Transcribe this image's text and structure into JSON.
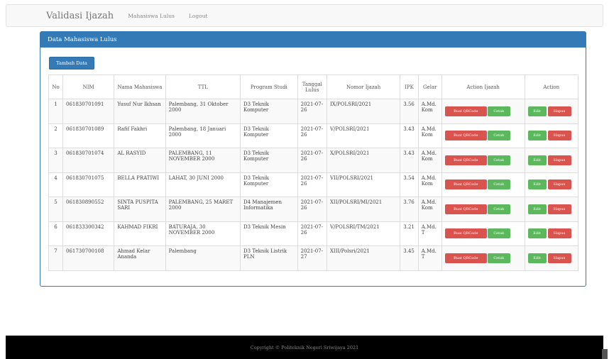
{
  "nav": {
    "brand": "Validasi Ijazah",
    "links": [
      "Mahasiswa Lulus",
      "Logout"
    ]
  },
  "panel": {
    "title": "Data Mahasiswa Lulus",
    "add_button": "Tambah Data"
  },
  "table": {
    "headers": [
      "No",
      "NIM",
      "Nama Mahasiswa",
      "TTL",
      "Program Studi",
      "Tanggal Lulus",
      "Nomor Ijazah",
      "IPK",
      "Gelar",
      "Action Ijazah",
      "Action"
    ],
    "rows": [
      {
        "no": "1",
        "nim": "061830701091",
        "nama": "Yusuf Nur Ikhsan",
        "ttl": "Palembang, 31 Oktober 2000",
        "prodi": "D3 Teknik Komputer",
        "tanggal": "2021-07-26",
        "ijazah": "IX/POLSRI/2021",
        "ipk": "3.56",
        "gelar": "A.Md. Kom"
      },
      {
        "no": "2",
        "nim": "061830701089",
        "nama": "Rafif Fakhri",
        "ttl": "Palembang, 18 Januari 2000",
        "prodi": "D3 Teknik Komputer",
        "tanggal": "2021-07-26",
        "ijazah": "V/POLSRI/2021",
        "ipk": "3.43",
        "gelar": "A.Md. Kom"
      },
      {
        "no": "3",
        "nim": "061830701074",
        "nama": "AL RASYID",
        "ttl": "PALEMBANG, 11 NOVEMBER 2000",
        "prodi": "D3 Teknik Komputer",
        "tanggal": "2021-07-26",
        "ijazah": "X/POLSRI/2021",
        "ipk": "3.43",
        "gelar": "A.Md. Kom"
      },
      {
        "no": "4",
        "nim": "061830701075",
        "nama": "BELLA PRATIWI",
        "ttl": "LAHAT, 30 JUNI 2000",
        "prodi": "D3 Teknik Komputer",
        "tanggal": "2021-07-26",
        "ijazah": "VII/POLSRI/2021",
        "ipk": "3.54",
        "gelar": "A.Md. Kom"
      },
      {
        "no": "5",
        "nim": "061830890552",
        "nama": "SINTA PUSPITA SARI",
        "ttl": "PALEMBANG, 25 MARET 2000",
        "prodi": "D4 Manajemen Informatika",
        "tanggal": "2021-07-26",
        "ijazah": "XII/POLSRI/MI/2021",
        "ipk": "3.76",
        "gelar": "A.Md. Kom"
      },
      {
        "no": "6",
        "nim": "061833300342",
        "nama": "KAHMAD FIKRI",
        "ttl": "BATURAJA, 30 NOVEMBER 2000",
        "prodi": "D3 Teknik Mesin",
        "tanggal": "2021-07-26",
        "ijazah": "V/POLSRI/TM/2021",
        "ipk": "3.21",
        "gelar": "A.Md. T"
      },
      {
        "no": "7",
        "nim": "061730700108",
        "nama": "Ahmad Kelar Ananda",
        "ttl": "Palembang",
        "prodi": "D3 Teknik Listrik PLN",
        "tanggal": "2021-07-27",
        "ijazah": "XIII/Polsri/2021",
        "ipk": "3.45",
        "gelar": "A.Md. T"
      }
    ],
    "buttons": {
      "qr": "Buat QRCode",
      "cetak": "Cetak",
      "edit": "Edit",
      "hapus": "Hapus"
    }
  },
  "footer": {
    "text": "Copyright © Politeknik Negeri Sriwijaya 2021"
  },
  "colors": {
    "primary": "#337ab7",
    "danger": "#d9534f",
    "success": "#5cb85c",
    "footer_bg": "#000000"
  }
}
